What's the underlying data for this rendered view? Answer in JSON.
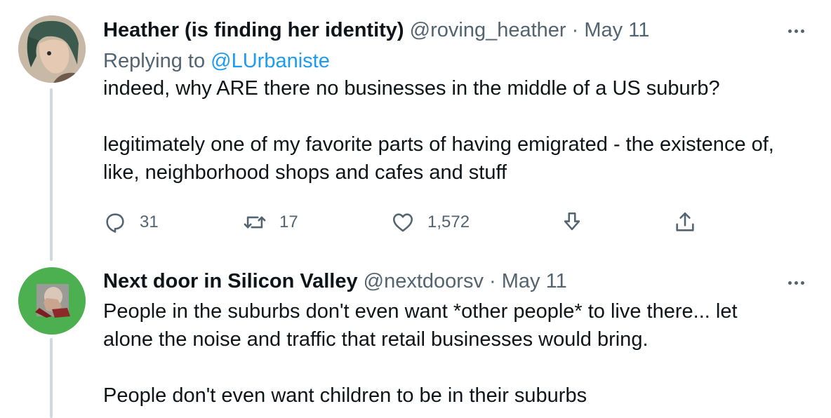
{
  "tweets": [
    {
      "display_name": "Heather (is finding her identity)",
      "handle": "@roving_heather",
      "separator": "·",
      "date": "May 11",
      "replying_prefix": "Replying to",
      "replying_to": "@LUrbaniste",
      "paragraphs": [
        "indeed, why ARE there no businesses in the middle of a US suburb?",
        "legitimately one of my favorite parts of having emigrated - the existence of,",
        "like, neighborhood shops and cafes and stuff"
      ],
      "actions": {
        "reply_count": "31",
        "retweet_count": "17",
        "like_count": "1,572"
      }
    },
    {
      "display_name": "Next door in Silicon Valley",
      "handle": "@nextdoorsv",
      "separator": "·",
      "date": "May 11",
      "paragraphs": [
        "People in the suburbs don't even want *other people* to live there... let",
        "alone the noise and traffic that retail businesses would bring.",
        "People don't even want children to be in their suburbs"
      ]
    }
  ],
  "colors": {
    "text_primary": "#0f1419",
    "text_secondary": "#536471",
    "link": "#1d9bf0",
    "thread_line": "#cfd9de",
    "avatar2_bg": "#4caf50"
  },
  "icons": [
    "reply-icon",
    "retweet-icon",
    "like-icon",
    "bookmark-icon",
    "share-icon",
    "more-icon"
  ]
}
